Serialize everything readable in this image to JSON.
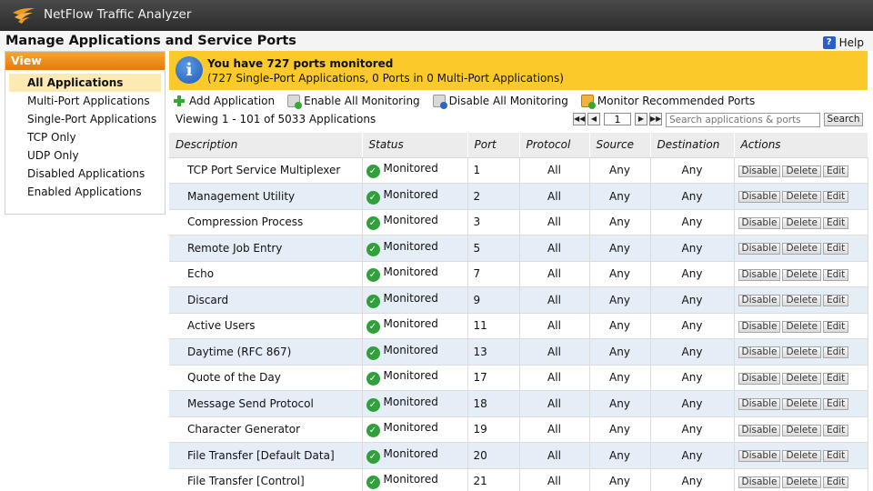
{
  "app": {
    "title": "NetFlow Traffic Analyzer"
  },
  "page": {
    "title": "Manage Applications and Service Ports",
    "help_label": "Help"
  },
  "sidebar": {
    "header": "View",
    "items": [
      {
        "label": "All Applications",
        "active": true
      },
      {
        "label": "Multi-Port Applications"
      },
      {
        "label": "Single-Port Applications"
      },
      {
        "label": "TCP Only"
      },
      {
        "label": "UDP Only"
      },
      {
        "label": "Disabled Applications"
      },
      {
        "label": "Enabled Applications"
      }
    ]
  },
  "banner": {
    "title": "You have 727 ports monitored",
    "subtitle": "(727 Single-Port Applications, 0 Ports in 0 Multi-Port Applications)"
  },
  "toolbar": {
    "add": "Add Application",
    "enable_all": "Enable All Monitoring",
    "disable_all": "Disable All Monitoring",
    "recommended": "Monitor Recommended Ports"
  },
  "viewing": "Viewing 1 - 101 of 5033 Applications",
  "pager": {
    "page": "1"
  },
  "search": {
    "placeholder": "Search applications & ports",
    "button": "Search"
  },
  "table": {
    "headers": [
      "Description",
      "Status",
      "Port",
      "Protocol",
      "Source",
      "Destination",
      "Actions"
    ],
    "action_labels": [
      "Disable",
      "Delete",
      "Edit"
    ],
    "rows": [
      {
        "description": "TCP Port Service Multiplexer",
        "status": "Monitored",
        "port": "1",
        "protocol": "All",
        "source": "Any",
        "destination": "Any"
      },
      {
        "description": "Management Utility",
        "status": "Monitored",
        "port": "2",
        "protocol": "All",
        "source": "Any",
        "destination": "Any"
      },
      {
        "description": "Compression Process",
        "status": "Monitored",
        "port": "3",
        "protocol": "All",
        "source": "Any",
        "destination": "Any"
      },
      {
        "description": "Remote Job Entry",
        "status": "Monitored",
        "port": "5",
        "protocol": "All",
        "source": "Any",
        "destination": "Any"
      },
      {
        "description": "Echo",
        "status": "Monitored",
        "port": "7",
        "protocol": "All",
        "source": "Any",
        "destination": "Any"
      },
      {
        "description": "Discard",
        "status": "Monitored",
        "port": "9",
        "protocol": "All",
        "source": "Any",
        "destination": "Any"
      },
      {
        "description": "Active Users",
        "status": "Monitored",
        "port": "11",
        "protocol": "All",
        "source": "Any",
        "destination": "Any"
      },
      {
        "description": "Daytime (RFC 867)",
        "status": "Monitored",
        "port": "13",
        "protocol": "All",
        "source": "Any",
        "destination": "Any"
      },
      {
        "description": "Quote of the Day",
        "status": "Monitored",
        "port": "17",
        "protocol": "All",
        "source": "Any",
        "destination": "Any"
      },
      {
        "description": "Message Send Protocol",
        "status": "Monitored",
        "port": "18",
        "protocol": "All",
        "source": "Any",
        "destination": "Any"
      },
      {
        "description": "Character Generator",
        "status": "Monitored",
        "port": "19",
        "protocol": "All",
        "source": "Any",
        "destination": "Any"
      },
      {
        "description": "File Transfer [Default Data]",
        "status": "Monitored",
        "port": "20",
        "protocol": "All",
        "source": "Any",
        "destination": "Any"
      },
      {
        "description": "File Transfer [Control]",
        "status": "Monitored",
        "port": "21",
        "protocol": "All",
        "source": "Any",
        "destination": "Any"
      }
    ]
  },
  "icons": {
    "logo": "solarwinds-logo-icon",
    "help": "help-icon",
    "info": "info-icon",
    "add": "plus-icon",
    "enable": "monitor-enable-icon",
    "disable": "monitor-disable-icon",
    "recommended": "recommended-icon",
    "status_ok": "check-circle-icon"
  },
  "colors": {
    "banner": "#fbc92a",
    "sidebar_header": "#f08f1a",
    "row_alt": "#e5eef6",
    "status_ok": "#2fa03a"
  }
}
